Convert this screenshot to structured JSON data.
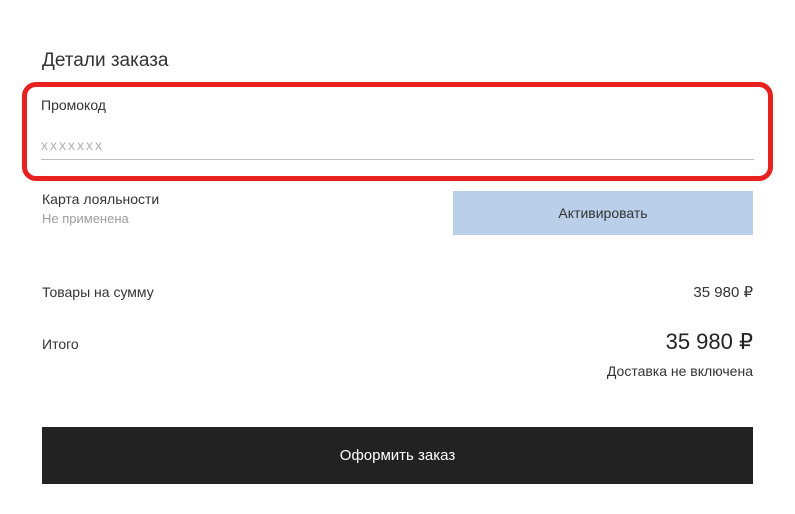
{
  "section_title": "Детали заказа",
  "promo": {
    "label": "Промокод",
    "placeholder": "xxxxxxx",
    "value": ""
  },
  "loyalty": {
    "label": "Карта лояльности",
    "status": "Не применена",
    "activate_button": "Активировать"
  },
  "summary": {
    "items_label": "Товары на сумму",
    "items_value": "35 980 ₽",
    "total_label": "Итого",
    "total_value": "35 980 ₽",
    "delivery_note": "Доставка не включена"
  },
  "checkout_button": "Оформить заказ"
}
